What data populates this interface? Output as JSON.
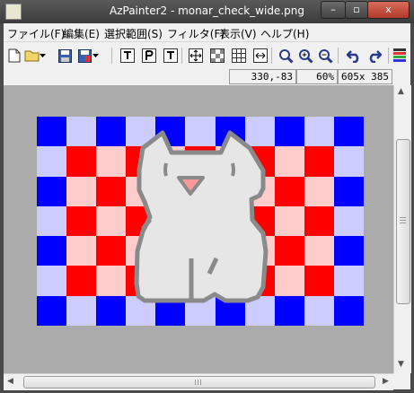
{
  "window": {
    "title": "AzPainter2 - monar_check_wide.png",
    "controls": {
      "minimize": "–",
      "maximize": "▫",
      "close": "x"
    }
  },
  "menu": [
    {
      "label": "ファイル(F)"
    },
    {
      "label": "編集(E)"
    },
    {
      "label": "選択範囲(S)"
    },
    {
      "label": "フィルタ(F)"
    },
    {
      "label": "表示(V)"
    },
    {
      "label": "ヘルプ(H)"
    }
  ],
  "status": {
    "coords": "330,-83",
    "zoom": "60%",
    "size": "605x 385"
  },
  "canvas": {
    "colors": {
      "blue": "#0000ff",
      "lavender": "#ccccff",
      "red": "#ff0000",
      "pink": "#ffcccc",
      "cat_fill": "#e6e6e6",
      "cat_stroke": "#8a8a8a",
      "nose": "#ff9999",
      "background": "#ababab"
    }
  },
  "icons": {
    "toolbar": [
      "new-file-icon",
      "open-folder-icon",
      "dropdown-arrow-icon",
      "save-icon",
      "save-as-icon",
      "dropdown-arrow-icon",
      "text-tool-icon",
      "text-bold-icon",
      "text-italic-icon",
      "fit-window-icon",
      "checker-icon",
      "grid-icon",
      "width-fit-icon",
      "zoom-icon",
      "zoom-in-icon",
      "zoom-out-icon",
      "undo-icon",
      "redo-icon",
      "palette-icon"
    ]
  }
}
